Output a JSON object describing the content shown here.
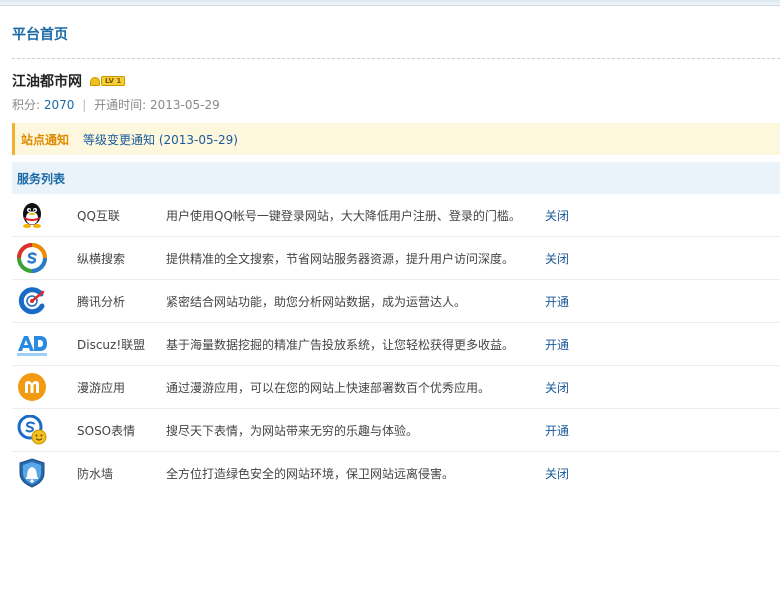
{
  "page": {
    "title": "平台首页"
  },
  "site": {
    "name": "江油都市网",
    "level": "LV 1",
    "points_label": "积分:",
    "points": "2070",
    "opened_label": "开通时间:",
    "opened_date": "2013-05-29"
  },
  "notice": {
    "label": "站点通知",
    "text": "等级变更通知 (2013-05-29)"
  },
  "services": {
    "header": "服务列表",
    "items": [
      {
        "name": "QQ互联",
        "desc": "用户使用QQ帐号一键登录网站，大大降低用户注册、登录的门槛。",
        "action": "关闭",
        "icon": "qq-penguin-icon"
      },
      {
        "name": "纵横搜索",
        "desc": "提供精准的全文搜索，节省网站服务器资源，提升用户访问深度。",
        "action": "关闭",
        "icon": "soso-search-icon"
      },
      {
        "name": "腾讯分析",
        "desc": "紧密结合网站功能，助您分析网站数据，成为运营达人。",
        "action": "开通",
        "icon": "analytics-icon"
      },
      {
        "name": "Discuz!联盟",
        "desc": "基于海量数据挖掘的精准广告投放系统，让您轻松获得更多收益。",
        "action": "开通",
        "icon": "ad-icon"
      },
      {
        "name": "漫游应用",
        "desc": "通过漫游应用，可以在您的网站上快速部署数百个优秀应用。",
        "action": "关闭",
        "icon": "manyou-icon"
      },
      {
        "name": "SOSO表情",
        "desc": "搜尽天下表情，为网站带来无穷的乐趣与体验。",
        "action": "开通",
        "icon": "emoticon-icon"
      },
      {
        "name": "防水墙",
        "desc": "全方位打造绿色安全的网站环境，保卫网站远离侵害。",
        "action": "关闭",
        "icon": "shield-icon"
      }
    ]
  }
}
